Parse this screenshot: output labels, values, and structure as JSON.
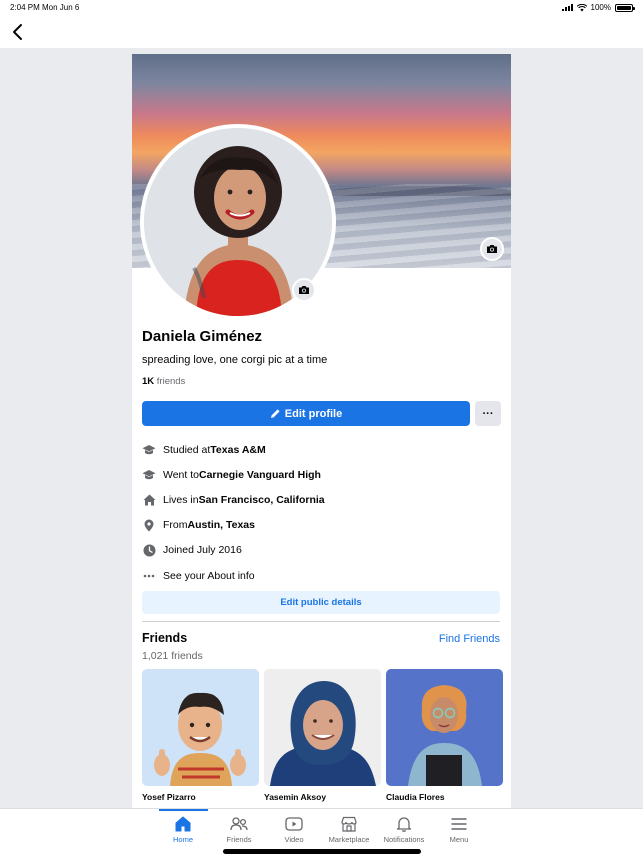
{
  "status_bar": {
    "time_date": "2:04 PM   Mon Jun 6",
    "battery": "100%"
  },
  "profile": {
    "name": "Daniela Giménez",
    "bio": "spreading love, one corgi pic at a time",
    "friend_count_value": "1K",
    "friend_count_label": " friends",
    "edit_profile_label": "Edit profile",
    "more_label": "···"
  },
  "details": [
    {
      "icon": "graduation-cap-icon",
      "prefix": "Studied at ",
      "value": "Texas A&M"
    },
    {
      "icon": "graduation-cap-icon",
      "prefix": "Went to ",
      "value": "Carnegie Vanguard High"
    },
    {
      "icon": "home-icon",
      "prefix": "Lives in ",
      "value": "San Francisco, California"
    },
    {
      "icon": "location-pin-icon",
      "prefix": "From ",
      "value": "Austin, Texas"
    },
    {
      "icon": "clock-icon",
      "prefix": "Joined July 2016",
      "value": ""
    },
    {
      "icon": "more-dots-icon",
      "prefix": "See your About info",
      "value": ""
    }
  ],
  "edit_public_details_label": "Edit public details",
  "friends": {
    "title": "Friends",
    "find_friends_label": "Find Friends",
    "count_label": "1,021 friends",
    "items": [
      {
        "name": "Yosef Pizarro"
      },
      {
        "name": "Yasemin Aksoy"
      },
      {
        "name": "Claudia Flores"
      }
    ]
  },
  "tab_bar": {
    "tabs": [
      {
        "label": "Home",
        "icon": "home-icon",
        "active": true
      },
      {
        "label": "Friends",
        "icon": "friends-icon",
        "active": false
      },
      {
        "label": "Video",
        "icon": "video-icon",
        "active": false
      },
      {
        "label": "Marketplace",
        "icon": "marketplace-icon",
        "active": false
      },
      {
        "label": "Notifications",
        "icon": "bell-icon",
        "active": false
      },
      {
        "label": "Menu",
        "icon": "menu-icon",
        "active": false
      }
    ]
  },
  "colors": {
    "accent": "#1b74e4",
    "accent_light": "#e7f3ff",
    "secondary_text": "#65676b",
    "background": "#e9ebef"
  }
}
